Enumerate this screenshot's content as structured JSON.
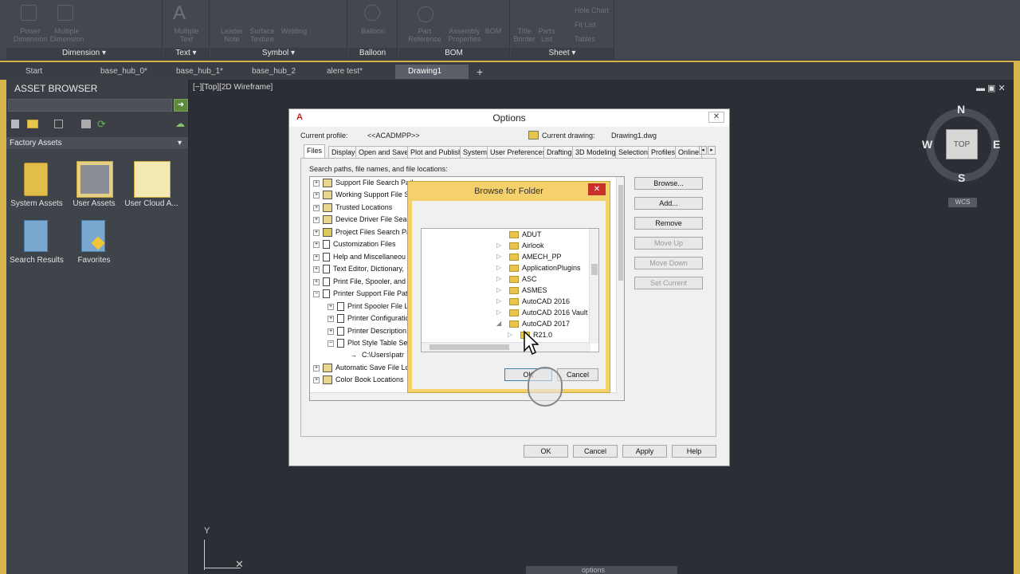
{
  "ribbon": {
    "panels": [
      {
        "title": "Dimension",
        "ghost_labels": [
          "Power\nDimension",
          "Multiple\nDimension"
        ]
      },
      {
        "title": "Text",
        "ghost_labels": [
          "Multiple\nText"
        ]
      },
      {
        "title": "Symbol",
        "ghost_labels": [
          "Leader\nNote",
          "Surface\nTexture",
          "Welding"
        ]
      },
      {
        "title": "Balloon",
        "ghost_labels": [
          "Balloon"
        ]
      },
      {
        "title": "BOM",
        "ghost_labels": [
          "Part\nReference",
          "Assembly\nProperties",
          "BOM"
        ]
      },
      {
        "title": "Sheet",
        "ghost_labels": [
          "Title\nBorder",
          "Parts\nList",
          "Hole Chart",
          "Fit List",
          "Tables"
        ]
      }
    ]
  },
  "doc_tabs": [
    "Start",
    "base_hub_0*",
    "base_hub_1*",
    "base_hub_2",
    "alere test*",
    "Drawing1"
  ],
  "active_tab": "Drawing1",
  "asset_browser": {
    "title": "ASSET BROWSER",
    "category": "Factory Assets",
    "items": [
      "System Assets",
      "User Assets",
      "User Cloud A...",
      "Search Results",
      "Favorites"
    ]
  },
  "viewport": {
    "label": "[−][Top][2D Wireframe]",
    "viewcube": {
      "n": "N",
      "s": "S",
      "e": "E",
      "w": "W",
      "top": "TOP",
      "wcs": "WCS"
    },
    "ucs": {
      "y": "Y"
    }
  },
  "options": {
    "title": "Options",
    "current_profile_label": "Current profile:",
    "current_profile": "<<ACADMPP>>",
    "current_drawing_label": "Current drawing:",
    "current_drawing": "Drawing1.dwg",
    "tabs": [
      "Files",
      "Display",
      "Open and Save",
      "Plot and Publish",
      "System",
      "User Preferences",
      "Drafting",
      "3D Modeling",
      "Selection",
      "Profiles",
      "Online"
    ],
    "search_label": "Search paths, file names, and file locations:",
    "tree": [
      "Support File Search Path",
      "Working Support File S",
      "Trusted Locations",
      "Device Driver File Sear",
      "Project Files Search Pa",
      "Customization Files",
      "Help and Miscellaneou",
      "Text Editor, Dictionary,",
      "Print File, Spooler, and",
      "Printer Support File Pat",
      "Print Spooler File L",
      "Printer Configuratio",
      "Printer Description",
      "Plot Style Table Se",
      "C:\\Users\\patr",
      "Automatic Save File Lo",
      "Color Book Locations"
    ],
    "buttons": {
      "browse": "Browse...",
      "add": "Add...",
      "remove": "Remove",
      "move_up": "Move Up",
      "move_down": "Move Down",
      "set_current": "Set Current"
    },
    "footer": {
      "ok": "OK",
      "cancel": "Cancel",
      "apply": "Apply",
      "help": "Help"
    }
  },
  "browse": {
    "title": "Browse for Folder",
    "folders": [
      "ADUT",
      "Airlook",
      "AMECH_PP",
      "ApplicationPlugins",
      "ASC",
      "ASMES",
      "AutoCAD 2016",
      "AutoCAD 2016 Vault",
      "AutoCAD 2017",
      "R21.0"
    ],
    "ok": "OK",
    "cancel": "Cancel"
  },
  "command_line": "options",
  "colors": {
    "accent": "#d7b54c",
    "canvas": "#2c2e35",
    "ribbon": "#43474f",
    "dialog_bg": "#f0f0f0",
    "browse_frame": "#f5d16b"
  }
}
